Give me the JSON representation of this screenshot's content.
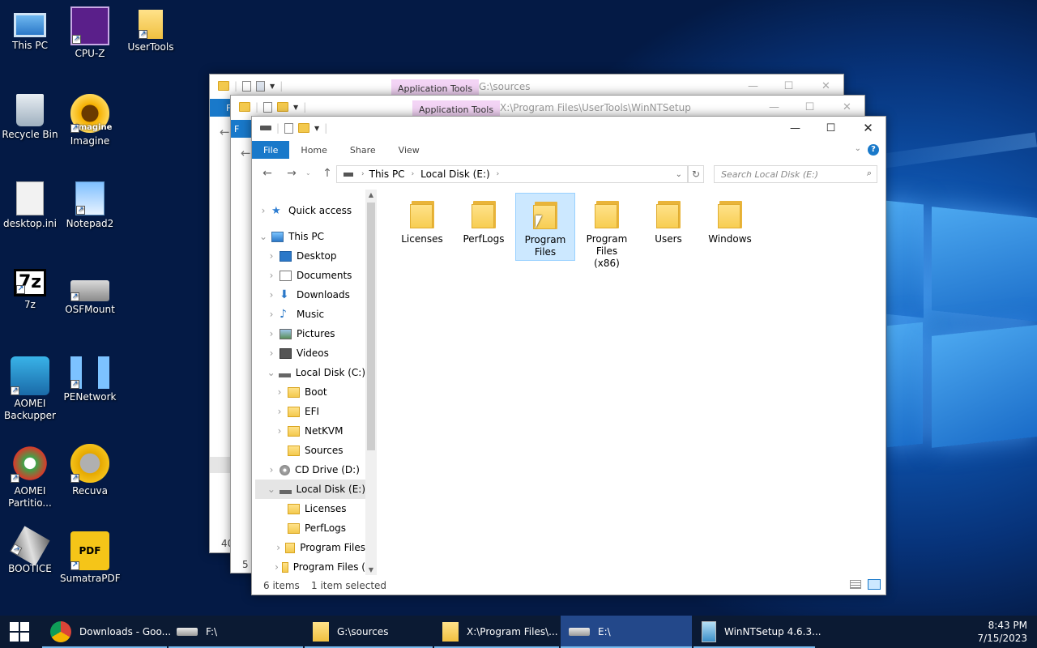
{
  "desktop_icons": [
    {
      "label": "This PC",
      "icon": "this-pc-icon",
      "shortcut": false
    },
    {
      "label": "CPU-Z",
      "icon": "cpuz-icon",
      "shortcut": true
    },
    {
      "label": "UserTools",
      "icon": "folder-icon",
      "shortcut": true
    },
    {
      "label": "Recycle Bin",
      "icon": "recycle-bin-icon",
      "shortcut": false
    },
    {
      "label": "Imagine",
      "icon": "imagine-icon",
      "shortcut": true
    },
    {
      "label": "desktop.ini",
      "icon": "settings-file-icon",
      "shortcut": false
    },
    {
      "label": "Notepad2",
      "icon": "notepad-icon",
      "shortcut": true
    },
    {
      "label": "7z",
      "icon": "7zip-icon",
      "shortcut": true
    },
    {
      "label": "OSFMount",
      "icon": "osfmount-icon",
      "shortcut": true
    },
    {
      "label": "AOMEI Backupper",
      "icon": "aomei-backupper-icon",
      "shortcut": true
    },
    {
      "label": "PENetwork",
      "icon": "network-icon",
      "shortcut": true
    },
    {
      "label": "AOMEI Partitio...",
      "icon": "aomei-partition-icon",
      "shortcut": true
    },
    {
      "label": "Recuva",
      "icon": "recuva-icon",
      "shortcut": true
    },
    {
      "label": "BOOTICE",
      "icon": "bootice-icon",
      "shortcut": true
    },
    {
      "label": "SumatraPDF",
      "icon": "pdf-icon",
      "shortcut": true
    }
  ],
  "imagine_overlay": "Imagine",
  "bg_window_1": {
    "context_tab": "Application Tools",
    "path": "G:\\sources",
    "status": "40",
    "ribbon_file": "F"
  },
  "bg_window_2": {
    "context_tab": "Application Tools",
    "path": "X:\\Program Files\\UserTools\\WinNTSetup",
    "status": "5",
    "ribbon_file": "F"
  },
  "main_window": {
    "ribbon_tabs": [
      "File",
      "Home",
      "Share",
      "View"
    ],
    "breadcrumb": [
      "This PC",
      "Local Disk (E:)"
    ],
    "search_placeholder": "Search Local Disk (E:)",
    "tree": [
      {
        "label": "Quick access",
        "indent": 0,
        "icon": "star",
        "chev": ">"
      },
      {
        "label": "This PC",
        "indent": 0,
        "icon": "pc",
        "chev": "v"
      },
      {
        "label": "Desktop",
        "indent": 1,
        "icon": "desktop",
        "chev": ">"
      },
      {
        "label": "Documents",
        "indent": 1,
        "icon": "documents",
        "chev": ">"
      },
      {
        "label": "Downloads",
        "indent": 1,
        "icon": "downloads",
        "chev": ">"
      },
      {
        "label": "Music",
        "indent": 1,
        "icon": "music",
        "chev": ">"
      },
      {
        "label": "Pictures",
        "indent": 1,
        "icon": "pictures",
        "chev": ">"
      },
      {
        "label": "Videos",
        "indent": 1,
        "icon": "videos",
        "chev": ">"
      },
      {
        "label": "Local Disk (C:)",
        "indent": 1,
        "icon": "drive",
        "chev": "v"
      },
      {
        "label": "Boot",
        "indent": 2,
        "icon": "folder",
        "chev": ">"
      },
      {
        "label": "EFI",
        "indent": 2,
        "icon": "folder",
        "chev": ">"
      },
      {
        "label": "NetKVM",
        "indent": 2,
        "icon": "folder",
        "chev": ">"
      },
      {
        "label": "Sources",
        "indent": 2,
        "icon": "folder",
        "chev": ""
      },
      {
        "label": "CD Drive (D:)",
        "indent": 1,
        "icon": "cd",
        "chev": ">"
      },
      {
        "label": "Local Disk (E:)",
        "indent": 1,
        "icon": "drive",
        "chev": "v",
        "selected": true
      },
      {
        "label": "Licenses",
        "indent": 2,
        "icon": "folder",
        "chev": ""
      },
      {
        "label": "PerfLogs",
        "indent": 2,
        "icon": "folder",
        "chev": ""
      },
      {
        "label": "Program Files",
        "indent": 2,
        "icon": "folder",
        "chev": ">"
      },
      {
        "label": "Program Files (",
        "indent": 2,
        "icon": "folder",
        "chev": ">"
      }
    ],
    "files": [
      {
        "label": "Licenses",
        "selected": false
      },
      {
        "label": "PerfLogs",
        "selected": false
      },
      {
        "label": "Program Files",
        "selected": true
      },
      {
        "label": "Program Files (x86)",
        "selected": false
      },
      {
        "label": "Users",
        "selected": false
      },
      {
        "label": "Windows",
        "selected": false
      }
    ],
    "status_items": "6 items",
    "status_selected": "1 item selected"
  },
  "taskbar": [
    {
      "label": "Downloads - Goo...",
      "icon": "chrome-icon",
      "active": false,
      "open": true
    },
    {
      "label": "F:\\",
      "icon": "drive-icon",
      "active": false,
      "open": true
    },
    {
      "label": "G:\\sources",
      "icon": "folder-icon",
      "active": false,
      "open": true
    },
    {
      "label": "X:\\Program Files\\...",
      "icon": "folder-icon",
      "active": false,
      "open": true
    },
    {
      "label": "E:\\",
      "icon": "drive-icon",
      "active": true,
      "open": true
    },
    {
      "label": "WinNTSetup 4.6.3...",
      "icon": "winntsetup-icon",
      "active": false,
      "open": true
    }
  ],
  "clock": {
    "time": "8:43 PM",
    "date": "7/15/2023"
  },
  "colors": {
    "accent": "#1979ca",
    "selection": "#cce8ff",
    "folder": "#f7cd52",
    "context_tab": "#f3d4f5"
  }
}
